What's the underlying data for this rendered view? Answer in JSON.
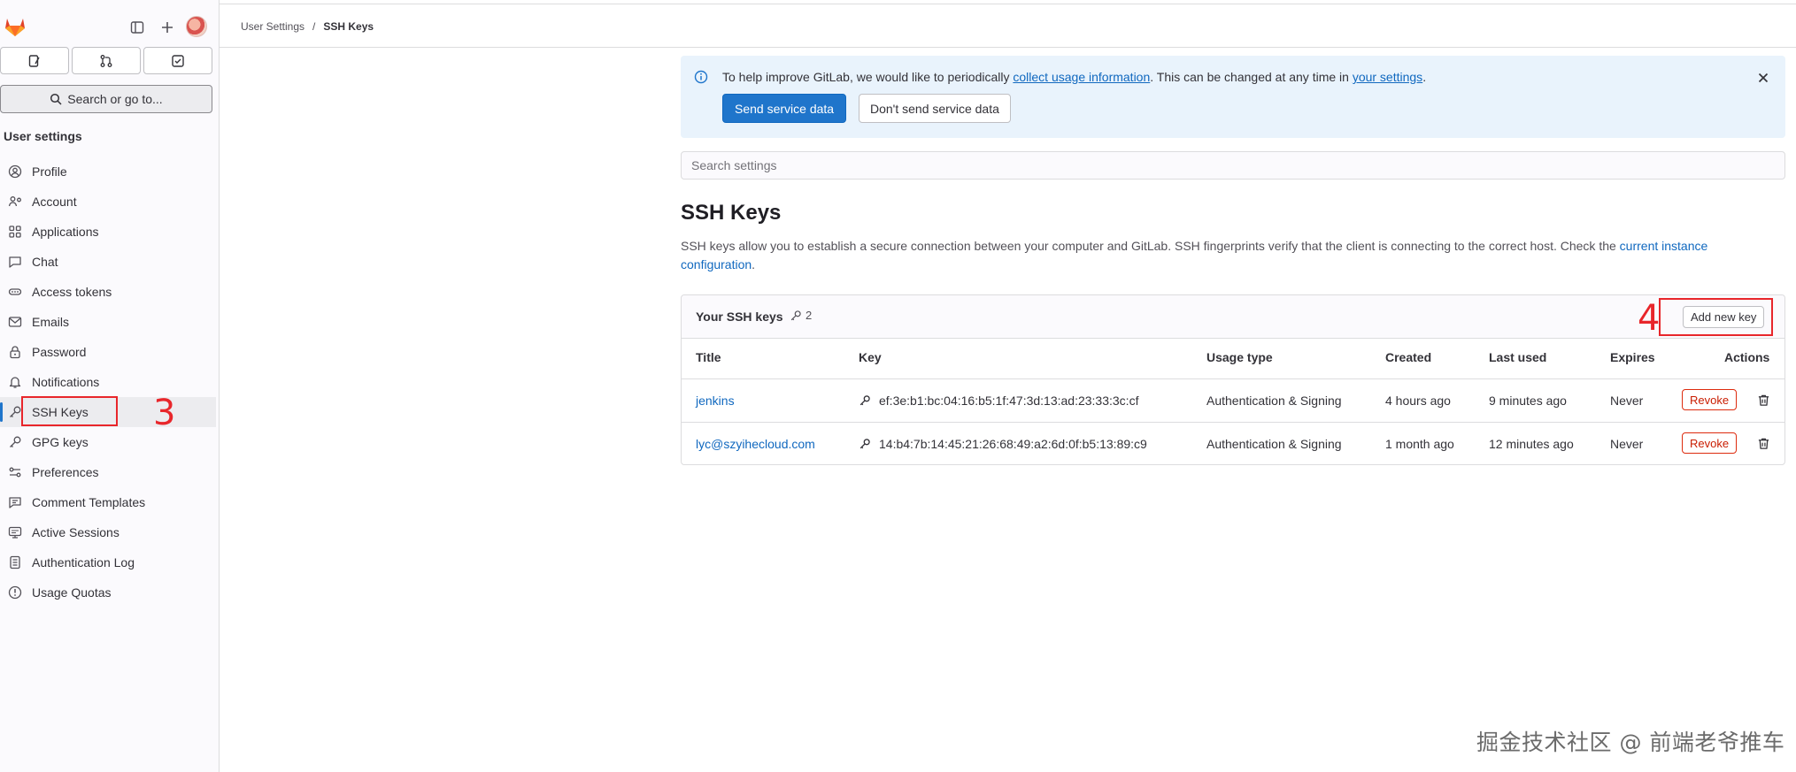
{
  "sidebar": {
    "heading": "User settings",
    "search_label": "Search or go to...",
    "items": [
      {
        "label": "Profile",
        "icon": "profile-icon"
      },
      {
        "label": "Account",
        "icon": "account-icon"
      },
      {
        "label": "Applications",
        "icon": "applications-icon"
      },
      {
        "label": "Chat",
        "icon": "chat-icon"
      },
      {
        "label": "Access tokens",
        "icon": "token-icon"
      },
      {
        "label": "Emails",
        "icon": "mail-icon"
      },
      {
        "label": "Password",
        "icon": "lock-icon"
      },
      {
        "label": "Notifications",
        "icon": "bell-icon"
      },
      {
        "label": "SSH Keys",
        "icon": "key-icon",
        "active": true
      },
      {
        "label": "GPG keys",
        "icon": "key-icon"
      },
      {
        "label": "Preferences",
        "icon": "preferences-icon"
      },
      {
        "label": "Comment Templates",
        "icon": "comment-icon"
      },
      {
        "label": "Active Sessions",
        "icon": "monitor-icon"
      },
      {
        "label": "Authentication Log",
        "icon": "log-icon"
      },
      {
        "label": "Usage Quotas",
        "icon": "quota-icon"
      }
    ]
  },
  "breadcrumb": {
    "parent": "User Settings",
    "separator": "/",
    "current": "SSH Keys"
  },
  "banner": {
    "text_before": "To help improve GitLab, we would like to periodically ",
    "link1": "collect usage information",
    "text_middle": ". This can be changed at any time in ",
    "link2": "your settings",
    "text_after": ".",
    "primary_button": "Send service data",
    "secondary_button": "Don't send service data"
  },
  "search": {
    "placeholder": "Search settings"
  },
  "page": {
    "title": "SSH Keys",
    "description": "SSH keys allow you to establish a secure connection between your computer and GitLab. SSH fingerprints verify that the client is connecting to the correct host. Check the ",
    "description_link_1": "current instance",
    "description_link_2": "configuration",
    "description_end": "."
  },
  "ssh_keys": {
    "card_title": "Your SSH keys",
    "count": "2",
    "add_button": "Add new key",
    "columns": [
      "Title",
      "Key",
      "Usage type",
      "Created",
      "Last used",
      "Expires",
      "Actions"
    ],
    "rows": [
      {
        "title": "jenkins",
        "key": "ef:3e:b1:bc:04:16:b5:1f:47:3d:13:ad:23:33:3c:cf",
        "usage": "Authentication & Signing",
        "created": "4 hours ago",
        "last_used": "9 minutes ago",
        "expires": "Never",
        "action": "Revoke"
      },
      {
        "title": "lyc@szyihecloud.com",
        "key": "14:b4:7b:14:45:21:26:68:49:a2:6d:0f:b5:13:89:c9",
        "usage": "Authentication & Signing",
        "created": "1 month ago",
        "last_used": "12 minutes ago",
        "expires": "Never",
        "action": "Revoke"
      }
    ]
  },
  "annotations": {
    "step3": "3",
    "step4": "4"
  },
  "watermark": "掘金技术社区 @ 前端老爷推车",
  "colors": {
    "primary": "#1f75cb",
    "link": "#1068bf",
    "danger": "#dd2b0e",
    "annotation": "#e8262b",
    "banner_bg": "#e9f3fc"
  }
}
